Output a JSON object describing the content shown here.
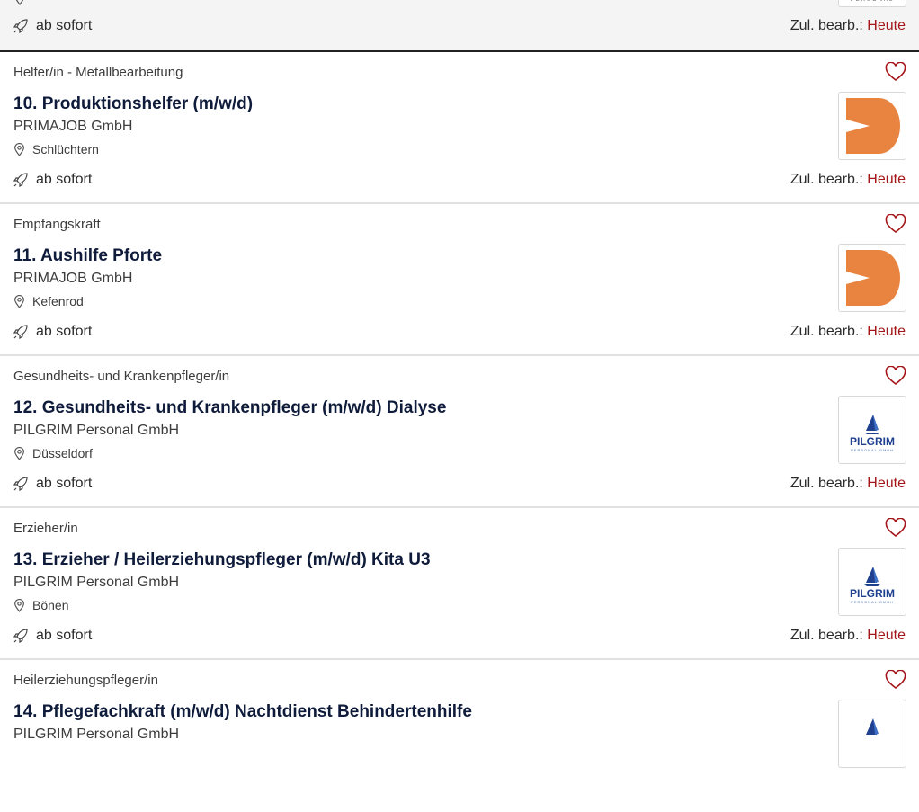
{
  "top_partial": {
    "start_label": "ab sofort",
    "edited_prefix": "Zul. bearb.:",
    "edited_value": "Heute",
    "logo_text": "PERSONAL"
  },
  "jobs": [
    {
      "category": "Helfer/in - Metallbearbeitung",
      "title": "10. Produktionshelfer (m/w/d)",
      "company": "PRIMAJOB GmbH",
      "location": "Schlüchtern",
      "start": "ab sofort",
      "edited_prefix": "Zul. bearb.:",
      "edited_value": "Heute",
      "logo": "primajob-logo"
    },
    {
      "category": "Empfangskraft",
      "title": "11. Aushilfe Pforte",
      "company": "PRIMAJOB GmbH",
      "location": "Kefenrod",
      "start": "ab sofort",
      "edited_prefix": "Zul. bearb.:",
      "edited_value": "Heute",
      "logo": "primajob-logo"
    },
    {
      "category": "Gesundheits- und Krankenpfleger/in",
      "title": "12. Gesundheits- und Krankenpfleger (m/w/d) Dialyse",
      "company": "PILGRIM Personal GmbH",
      "location": "Düsseldorf",
      "start": "ab sofort",
      "edited_prefix": "Zul. bearb.:",
      "edited_value": "Heute",
      "logo": "pilgrim-logo",
      "logo_text": "PILGRIM",
      "logo_subtext": "PERSONAL GMBH"
    },
    {
      "category": "Erzieher/in",
      "title": "13. Erzieher / Heilerziehungspfleger (m/w/d) Kita U3",
      "company": "PILGRIM Personal GmbH",
      "location": "Bönen",
      "start": "ab sofort",
      "edited_prefix": "Zul. bearb.:",
      "edited_value": "Heute",
      "logo": "pilgrim-logo",
      "logo_text": "PILGRIM",
      "logo_subtext": "PERSONAL GMBH"
    },
    {
      "category": "Heilerziehungspfleger/in",
      "title": "14. Pflegefachkraft (m/w/d) Nachtdienst Behindertenhilfe",
      "company": "PILGRIM Personal GmbH",
      "logo": "pilgrim-logo"
    }
  ],
  "colors": {
    "accent_red": "#a4161a",
    "primajob_orange": "#e8843f",
    "pilgrim_blue": "#1f3f8f",
    "title_navy": "#0f1b3a"
  }
}
